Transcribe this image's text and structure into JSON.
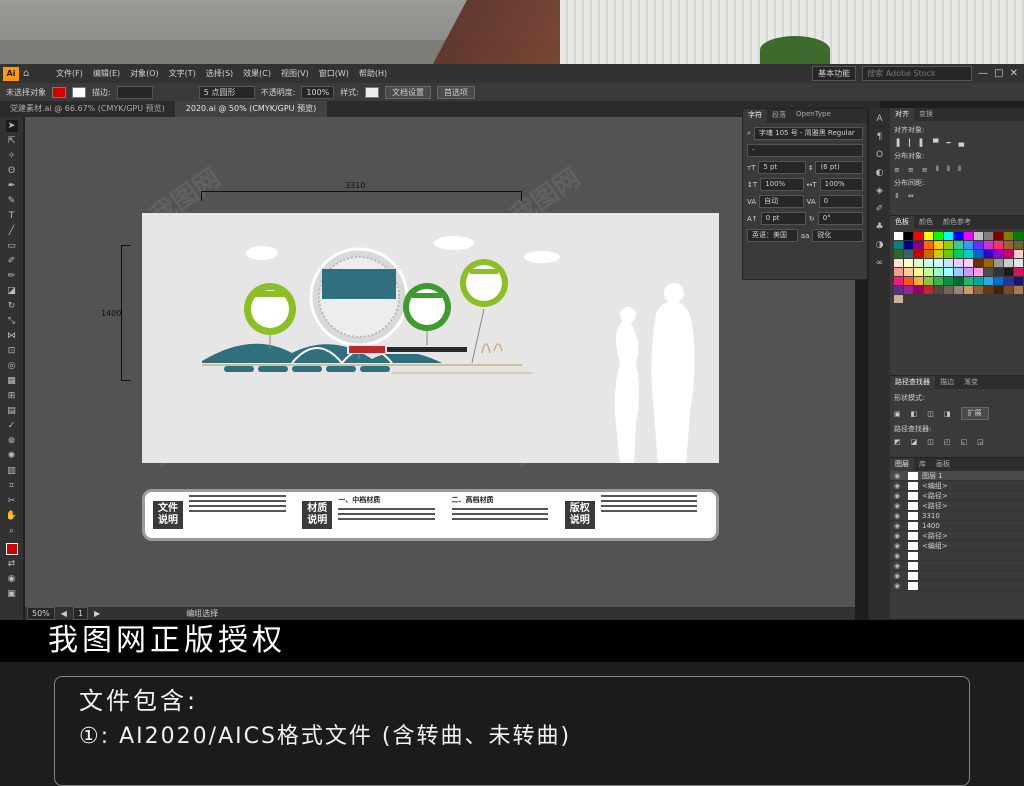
{
  "menubar": {
    "items": [
      "文件(F)",
      "编辑(E)",
      "对象(O)",
      "文字(T)",
      "选择(S)",
      "效果(C)",
      "视图(V)",
      "窗口(W)",
      "帮助(H)"
    ],
    "workspace": "基本功能",
    "search_placeholder": "搜索 Adobe Stock"
  },
  "control": {
    "selection": "未选择对象",
    "stroke_label": "描边:",
    "brush": "5 点圆形",
    "opacity_label": "不透明度:",
    "opacity": "100%",
    "style_label": "样式:",
    "doc_setup": "文档设置",
    "prefs": "首选项"
  },
  "tabs": [
    {
      "label": "党建素材.ai @ 66.67% (CMYK/GPU 预览)",
      "active": false
    },
    {
      "label": "2020.ai @ 50% (CMYK/GPU 预览)",
      "active": true
    }
  ],
  "artboard": {
    "width_label": "3310",
    "height_label": "1400",
    "info": {
      "box1": "文件说明",
      "box2": "材质说明",
      "col2_title": "一、中档材质",
      "col3_title": "二、高档材质",
      "box3": "版权说明"
    }
  },
  "status": {
    "zoom": "50%",
    "page": "1",
    "tool": "编组选择"
  },
  "char_panel": {
    "tabs": [
      "字符",
      "段落",
      "OpenType"
    ],
    "font": "字魂 105 号 - 简雅黑 Regular",
    "style": "-",
    "size": "5 pt",
    "leading": "(6 pt)",
    "hscale": "100%",
    "vscale": "100%",
    "kern": "自动",
    "track": "0",
    "baseline": "0 pt",
    "rotate": "0°",
    "lang": "英语：美国",
    "aa": "锐化"
  },
  "right_panel": {
    "align_tabs": [
      "对齐",
      "变换"
    ],
    "align_objects": "对齐对象:",
    "distribute_objects": "分布对象:",
    "distribute_spacing": "分布间距:",
    "swatch_tabs": [
      "色板",
      "颜色",
      "颜色参考"
    ],
    "pathfinder_tabs": [
      "路径查找器",
      "描边",
      "渐变"
    ],
    "shape_modes": "形状模式:",
    "expand": "扩展",
    "pathfinders": "路径查找器:",
    "layer_tabs": [
      "图层",
      "库",
      "画板"
    ],
    "layers": [
      "图层 1",
      "<编组>",
      "<路径>",
      "<路径>",
      "3310",
      "1400",
      "<路径>",
      "<编组>",
      "",
      "",
      "",
      ""
    ]
  },
  "swatches": [
    "#ffffff",
    "#000000",
    "#ff0000",
    "#ffff00",
    "#00ff00",
    "#00ffff",
    "#0000ff",
    "#ff00ff",
    "#c0c0c0",
    "#808080",
    "#800000",
    "#808000",
    "#008000",
    "#008080",
    "#000080",
    "#800080",
    "#ff6600",
    "#ffcc00",
    "#99cc00",
    "#33cc99",
    "#3399ff",
    "#6633ff",
    "#cc33cc",
    "#ff3366",
    "#996633",
    "#666633",
    "#336633",
    "#336666",
    "#cc0000",
    "#cc6600",
    "#cccc00",
    "#66cc00",
    "#00cc66",
    "#00cccc",
    "#0066cc",
    "#3300cc",
    "#9900cc",
    "#cc0066",
    "#ffcccc",
    "#ffe5cc",
    "#ffffcc",
    "#e5ffcc",
    "#ccffe5",
    "#ccffff",
    "#cce5ff",
    "#e5ccff",
    "#ffccf2",
    "#663300",
    "#996600",
    "#999999",
    "#cccccc",
    "#e6e6e6",
    "#ff9999",
    "#ffcc99",
    "#ffff99",
    "#ccff99",
    "#99ffcc",
    "#99ffff",
    "#99ccff",
    "#cc99ff",
    "#ff99e6",
    "#4d4d4d",
    "#333333",
    "#1a1a1a",
    "#d4145a",
    "#ed1e79",
    "#f15a24",
    "#fbb03b",
    "#8cc63f",
    "#39b54a",
    "#009245",
    "#006837",
    "#22b573",
    "#00a99d",
    "#29abe2",
    "#0071bc",
    "#2e3192",
    "#1b1464",
    "#662d91",
    "#93278f",
    "#9e005d",
    "#c1272d",
    "#534741",
    "#736357",
    "#998675",
    "#c69c6d",
    "#8c6239",
    "#603813",
    "#42210b",
    "#754c24",
    "#a67c52",
    "#c7b299"
  ],
  "banner": {
    "title": "我图网正版授权"
  },
  "file_info": {
    "title": "文件包含:",
    "line1": "①: AI2020/AICS格式文件 (含转曲、未转曲)"
  },
  "watermark": "我图网"
}
